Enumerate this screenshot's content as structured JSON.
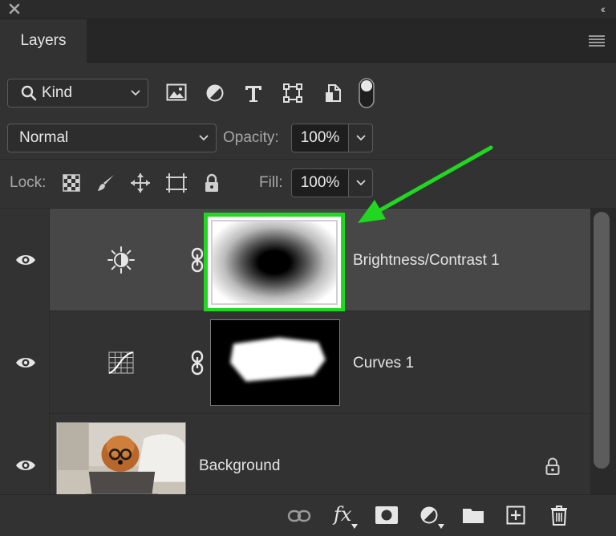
{
  "panel": {
    "tab_label": "Layers",
    "collapse_glyph": "‹‹"
  },
  "filter": {
    "kind_label": "Kind"
  },
  "blend": {
    "mode": "Normal",
    "opacity_label": "Opacity:",
    "opacity_value": "100%"
  },
  "lock": {
    "label": "Lock:",
    "fill_label": "Fill:",
    "fill_value": "100%"
  },
  "layers": [
    {
      "name": "Brightness/Contrast 1",
      "type": "adjustment",
      "icon": "brightness-contrast-icon",
      "selected": true
    },
    {
      "name": "Curves 1",
      "type": "adjustment",
      "icon": "curves-icon",
      "selected": false
    },
    {
      "name": "Background",
      "type": "image",
      "icon": "lock-icon",
      "selected": false
    }
  ],
  "colors": {
    "panel_bg": "#323232",
    "selected_row": "#474747",
    "highlight_green": "#22d722"
  },
  "footer_icons": [
    "link-layers-icon",
    "fx-icon",
    "add-mask-icon",
    "adjustment-layer-icon",
    "new-group-icon",
    "new-layer-icon",
    "trash-icon"
  ],
  "footer": {
    "fx_label": "fx"
  }
}
